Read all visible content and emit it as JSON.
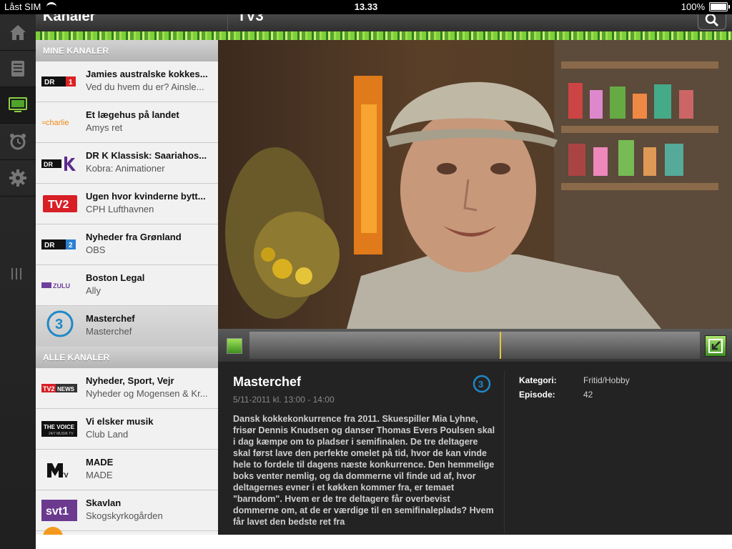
{
  "status": {
    "carrier": "Låst SIM",
    "time": "13.33",
    "battery": "100%"
  },
  "header": {
    "left_title": "Kanaler",
    "right_title": "TV3"
  },
  "colors": {
    "accent_green": "#7fcf3a",
    "playhead": "#e8c63a"
  },
  "nav": [
    "home-icon",
    "guide-icon",
    "tv-icon",
    "alarm-icon",
    "settings-icon"
  ],
  "mine_kanaler": {
    "label": "MINE KANALER",
    "rows": [
      {
        "logo": "DR1",
        "title": "Jamies australske kokkes...",
        "sub": "Ved du hvem du er? Ainsle..."
      },
      {
        "logo": "charlie",
        "title": "Et lægehus på landet",
        "sub": "Amys ret"
      },
      {
        "logo": "DR K",
        "title": "DR K Klassisk: Saariahos...",
        "sub": "Kobra: Animationer"
      },
      {
        "logo": "TV2",
        "title": "Ugen hvor kvinderne bytt...",
        "sub": "CPH Lufthavnen"
      },
      {
        "logo": "DR2",
        "title": "Nyheder fra Grønland",
        "sub": "OBS"
      },
      {
        "logo": "TV2 ZULU",
        "title": "Boston Legal",
        "sub": "Ally"
      },
      {
        "logo": "TV3",
        "title": "Masterchef",
        "sub": "Masterchef"
      }
    ]
  },
  "alle_kanaler": {
    "label": "ALLE KANALER",
    "rows": [
      {
        "logo": "TV2 NEWS",
        "title": "Nyheder, Sport, Vejr",
        "sub": "Nyheder og Mogensen & Kr..."
      },
      {
        "logo": "THE VOICE",
        "title": "Vi elsker musik",
        "sub": "Club Land"
      },
      {
        "logo": "MTV",
        "title": "MADE",
        "sub": "MADE"
      },
      {
        "logo": "svt1",
        "title": "Skavlan",
        "sub": "Skogskyrkogården"
      }
    ]
  },
  "program": {
    "title": "Masterchef",
    "time": "5/11-2011 kl. 13:00 - 14:00",
    "description": "Dansk kokkekonkurrence fra 2011. Skuespiller Mia Lyhne, frisør Dennis Knudsen og danser Thomas Evers Poulsen skal i dag kæmpe om to pladser i semifinalen. De tre deltagere skal først lave den perfekte omelet på tid, hvor de kan vinde hele to fordele til dagens næste konkurrence. Den hemmelige boks venter nemlig, og da dommerne vil finde ud af, hvor deltagernes evner i et køkken kommer fra, er temaet \"barndom\". Hvem er de tre deltagere får overbevist dommerne om, at de er værdige til en semifinaleplads? Hvem får lavet den bedste ret fra",
    "kategori_label": "Kategori:",
    "kategori": "Fritid/Hobby",
    "episode_label": "Episode:",
    "episode": "42"
  }
}
